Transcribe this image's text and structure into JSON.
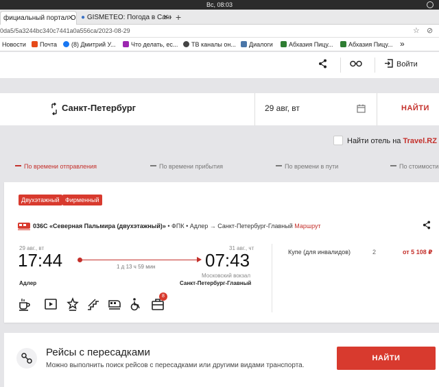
{
  "os": {
    "clock": "Вс, 08:03"
  },
  "browser": {
    "tabs": [
      {
        "label": "фициальный портал О",
        "active": true
      },
      {
        "label": "GISMETEO: Погода в Санк",
        "active": false
      }
    ],
    "url": "0da5/5a3244bc340c7441a0a556ca/2023-08-29",
    "bookmarks": [
      {
        "label": "Новости",
        "color": "#3b5998"
      },
      {
        "label": "Почта",
        "color": "#e64a19"
      },
      {
        "label": "(8) Дмитрий У...",
        "color": "#1877f2"
      },
      {
        "label": "Что делать, ес...",
        "color": "#9c27b0"
      },
      {
        "label": "ТВ каналы он...",
        "color": "#444444"
      },
      {
        "label": "Диалоги",
        "color": "#4a76a8"
      },
      {
        "label": "Абхазия Пицу...",
        "color": "#2e7d32"
      },
      {
        "label": "Абхазия Пицу...",
        "color": "#2e7d32"
      }
    ]
  },
  "header": {
    "login_label": "Войти"
  },
  "search": {
    "from": "Санкт-Петербург",
    "date": "29 авг, вт",
    "find_label": "НАЙТИ"
  },
  "hotel": {
    "prefix": "Найти отель на",
    "brand": "Travel.RZ"
  },
  "sort": {
    "items": [
      "По времени отправления",
      "По времени прибытия",
      "По времени в пути",
      "По стоимости"
    ]
  },
  "train": {
    "badges": [
      "Двухэтажный",
      "Фирменный"
    ],
    "number_name": "036С «Северная Пальмира (двухэтажный)»",
    "info": " • ФПК • Адлер → Санкт-Петербург-Главный ",
    "route_link": "Маршрут",
    "dep_date": "29 авг., вт",
    "dep_time": "17:44",
    "arr_date": "31 авг., чт",
    "arr_time": "07:43",
    "duration": "1 д 13 ч 59 мин",
    "arr_station": "Московский вокзал",
    "dep_city": "Адлер",
    "arr_city": "Санкт-Петербург-Главный",
    "notification_count": "8",
    "class_name": "Купе (для инвалидов)",
    "seats": "2",
    "price": "от 5 108 ₽"
  },
  "transfers": {
    "title": "Рейсы с пересадками",
    "subtitle": "Можно выполнить поиск рейсов с пересадками или другими видами транспорта.",
    "button_label": "НАЙТИ"
  },
  "colors": {
    "accent": "#d83a2e",
    "link": "#c4302b"
  }
}
